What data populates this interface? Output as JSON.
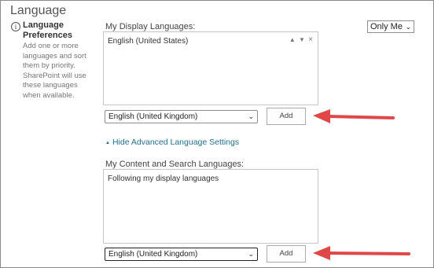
{
  "section": {
    "title": "Language"
  },
  "preferences": {
    "title": "Language Preferences",
    "description": "Add one or more languages and sort them by priority. SharePoint will use these languages when available."
  },
  "privacy": {
    "selected": "Only Me"
  },
  "display_languages": {
    "label": "My Display Languages:",
    "items": [
      "English (United States)"
    ],
    "controls": {
      "up": "▲",
      "down": "▼",
      "remove": "×"
    },
    "dropdown_selected": "English (United Kingdom)",
    "add_label": "Add"
  },
  "advanced_toggle": {
    "label": "Hide Advanced Language Settings"
  },
  "content_languages": {
    "label": "My Content and Search Languages:",
    "items": [
      "Following my display languages"
    ],
    "dropdown_selected": "English (United Kingdom)",
    "add_label": "Add"
  },
  "colors": {
    "annotation_arrow": "#e04848",
    "link": "#1f6f8f"
  }
}
